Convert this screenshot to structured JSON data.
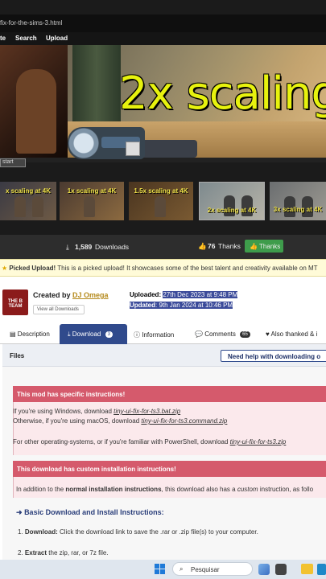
{
  "browser": {
    "url_fragment": "fix-for-the-sims-3.html"
  },
  "nav": {
    "items": [
      "te",
      "Search",
      "Upload"
    ]
  },
  "hero": {
    "title": "2x scaling",
    "start_label": "start"
  },
  "thumbnails": [
    {
      "caption": "x scaling at 4K"
    },
    {
      "caption": "1x scaling at 4K"
    },
    {
      "caption": "1.5x scaling at 4K"
    },
    {
      "caption": "2x scaling at 4K"
    },
    {
      "caption": "3x scaling at 4K"
    }
  ],
  "stats": {
    "downloads": "1,589",
    "downloads_label": "Downloads",
    "thanks_count": "76",
    "thanks_label": "Thanks",
    "thanks_button": "Thanks"
  },
  "picked": {
    "label": "Picked Upload!",
    "text": "This is a picked upload! It showcases some of the best talent and creativity available on MT"
  },
  "creator": {
    "logo_text": "THE B TEAM",
    "created_by": "Created by",
    "author": "DJ Omega",
    "view_all": "View all Downloads"
  },
  "dates": {
    "uploaded_label": "Uploaded:",
    "uploaded_value": "27th Dec 2023 at 9:48 PM",
    "updated_label": "Updated",
    "updated_value": ": 9th Jan 2024 at 10:46 PM"
  },
  "tabs": [
    {
      "label": "Description",
      "badge": ""
    },
    {
      "label": "Download",
      "badge": "3"
    },
    {
      "label": "Information",
      "badge": ""
    },
    {
      "label": "Comments",
      "badge": "65"
    },
    {
      "label": "Also thanked & i",
      "badge": ""
    }
  ],
  "files": {
    "title": "Files",
    "help_button": "Need help with downloading o"
  },
  "instructions": {
    "specific_title": "This mod has specific instructions!",
    "windows_text": "If you're using Windows, download",
    "windows_link": "tiny-ui-fix-for-ts3.bat.zip",
    "mac_text": "Otherwise, if you're using macOS, download",
    "mac_link": "tiny-ui-fix-for-ts3.command.zip",
    "other_text": "For other operating-systems, or if you're familiar with PowerShell, download",
    "other_link": "tiny-ui-fix-for-ts3.zip",
    "custom_title": "This download has custom installation instructions!",
    "custom_text_a": "In addition to the",
    "custom_text_b": "normal installation instructions",
    "custom_text_c": ", this download also has a",
    "custom_text_d": "custom",
    "custom_text_e": "instruction, as follo",
    "basic_title": "Basic Download and Install Instructions:",
    "step1_num": "1.",
    "step1_bold": "Download:",
    "step1_text": "Click the download link to save the .rar or .zip file(s) to your computer.",
    "step2_num": "2.",
    "step2_bold": "Extract",
    "step2_text": "the zip, rar, or 7z file."
  },
  "taskbar": {
    "search_placeholder": "Pesquisar"
  },
  "colors": {
    "accent_blue": "#304a8c",
    "red_bar": "#d55a6c",
    "hero_title": "#e7f20e",
    "thanks_green": "#3e9c4b"
  }
}
